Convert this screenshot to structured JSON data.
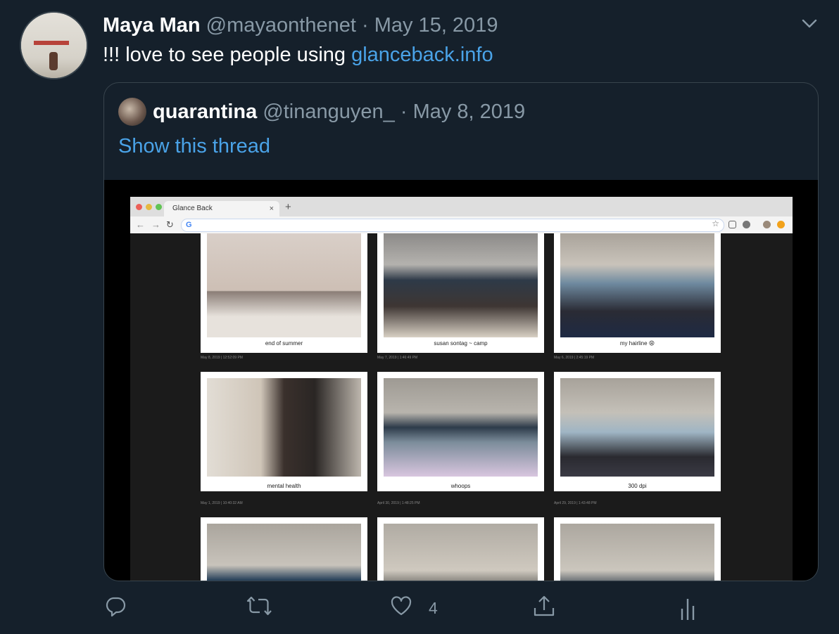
{
  "tweet": {
    "author_name": "Maya Man",
    "author_handle": "@mayaonthenet",
    "separator": "·",
    "date": "May 15, 2019",
    "text_prefix": "!!! love to see people using ",
    "link_text": "glanceback.info"
  },
  "quoted": {
    "author_name": "quarantina",
    "author_handle": "@tinanguyen_",
    "separator": "·",
    "date": "May 8, 2019",
    "thread_link": "Show this thread",
    "browser": {
      "tab_title": "Glance Back",
      "tab_close": "×",
      "new_tab": "+",
      "omnibox_icon": "G",
      "cards": [
        {
          "caption": "end of summer",
          "stamp": "May 8, 2019 | 12:52:09 PM"
        },
        {
          "caption": "susan sontag ~ camp",
          "stamp": "May 7, 2019 | 1:46:49 PM"
        },
        {
          "caption": "my hairline 😩",
          "stamp": "May 6, 2019 | 2:45:19 PM"
        },
        {
          "caption": "mental health",
          "stamp": "May 1, 2019 | 10:40:32 AM"
        },
        {
          "caption": "whoops",
          "stamp": "April 30, 2019 | 1:48:25 PM"
        },
        {
          "caption": "300 dpi",
          "stamp": "April 29, 2019 | 1:43:48 PM"
        }
      ]
    }
  },
  "actions": {
    "like_count": "4"
  },
  "colors": {
    "background": "#15202b",
    "muted": "#8899a6",
    "link": "#4aa3e8",
    "border": "#38444d"
  },
  "icons": [
    "chevron-down-icon",
    "reply-icon",
    "retweet-icon",
    "like-icon",
    "share-icon",
    "analytics-icon"
  ]
}
